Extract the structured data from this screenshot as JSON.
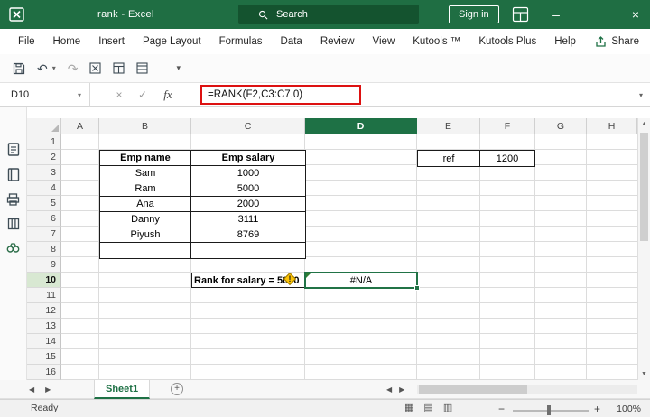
{
  "titlebar": {
    "title": "rank - Excel",
    "search_placeholder": "Search",
    "sign_in_label": "Sign in"
  },
  "menu": {
    "tabs": [
      "File",
      "Home",
      "Insert",
      "Page Layout",
      "Formulas",
      "Data",
      "Review",
      "View",
      "Kutools ™",
      "Kutools Plus",
      "Help"
    ],
    "share_label": "Share"
  },
  "formula_bar": {
    "name_box": "D10",
    "fx_label": "fx",
    "formula": "=RANK(F2,C3:C7,0)"
  },
  "grid": {
    "columns": [
      "A",
      "B",
      "C",
      "D",
      "E",
      "F",
      "G",
      "H"
    ],
    "rows": [
      "1",
      "2",
      "3",
      "4",
      "5",
      "6",
      "7",
      "8",
      "9",
      "10",
      "11",
      "12",
      "13",
      "14",
      "15",
      "16"
    ],
    "selected_cell": "D10",
    "selected_column": "D",
    "selected_row": "10"
  },
  "cells": {
    "emp_table": [
      [
        "Emp name",
        "Emp salary"
      ],
      [
        "Sam",
        "1000"
      ],
      [
        "Ram",
        "5000"
      ],
      [
        "Ana",
        "2000"
      ],
      [
        "Danny",
        "3111"
      ],
      [
        "Piyush",
        "8769"
      ],
      [
        "",
        ""
      ]
    ],
    "ref_table": {
      "label": "ref",
      "value": "1200"
    },
    "rank_label": "Rank for salary = 5000",
    "result": "#N/A"
  },
  "sheet_bar": {
    "active_tab": "Sheet1"
  },
  "status_bar": {
    "mode": "Ready",
    "zoom": "100%"
  },
  "icons": {
    "warning_bang": "!",
    "minimize": "–",
    "close": "×",
    "cancel": "×",
    "enter": "✓",
    "dropdown": "▾",
    "up": "▲",
    "down": "▼",
    "left": "◀",
    "right": "▶",
    "plus": "+",
    "zoom_minus": "−",
    "zoom_plus": "+",
    "view_normal": "▦",
    "view_layout": "▤",
    "view_break": "▥",
    "undo": "↶",
    "redo": "↷"
  },
  "colors": {
    "titlebar_green": "#1f6e43",
    "accent_green": "#1e7145",
    "selection_green": "#217346",
    "formula_highlight_red": "#dd1111",
    "warning_yellow": "#fcc205"
  }
}
